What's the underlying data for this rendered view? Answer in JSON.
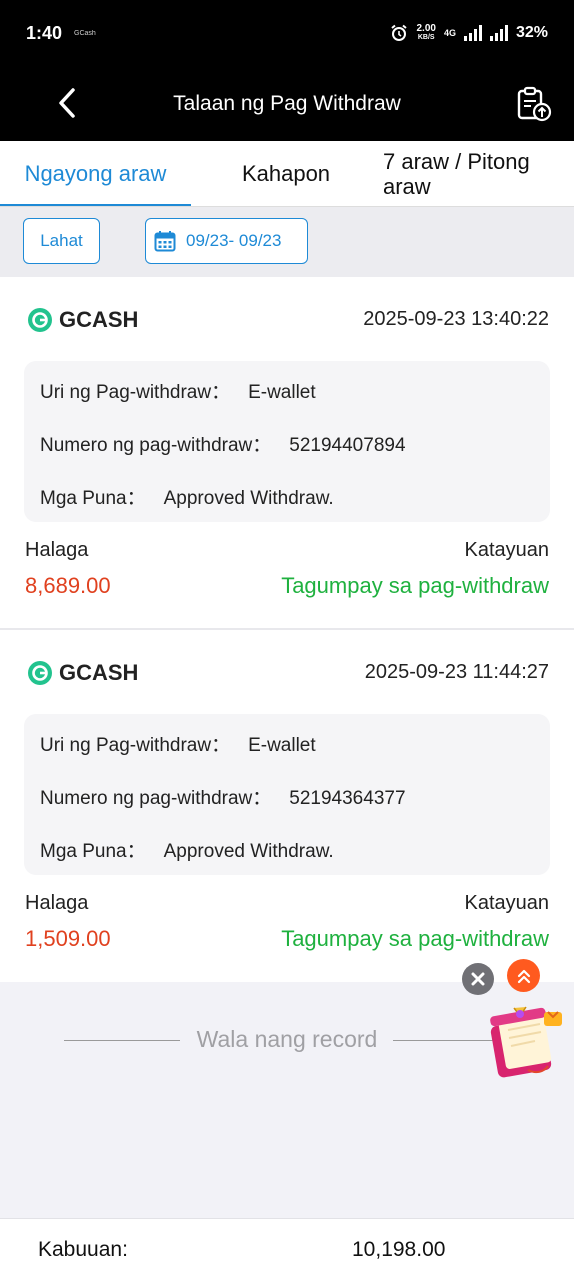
{
  "status_bar": {
    "time": "1:40",
    "app_hint": "GCash",
    "speed_value": "2.00",
    "speed_unit": "KB/S",
    "network": "4G",
    "battery": "32%"
  },
  "header": {
    "title": "Talaan ng Pag Withdraw",
    "back_icon": "back-chevron-icon",
    "export_icon": "clipboard-upload-icon"
  },
  "tabs": [
    {
      "label": "Ngayong araw",
      "active": true
    },
    {
      "label": "Kahapon",
      "active": false
    },
    {
      "label": "7 araw / Pitong araw",
      "active": false
    }
  ],
  "filters": {
    "all_label": "Lahat",
    "date_range": "09/23- 09/23",
    "calendar_icon": "calendar-icon"
  },
  "records": [
    {
      "provider": "GCASH",
      "timestamp": "2025-09-23 13:40:22",
      "type_label": "Uri ng Pag-withdraw：",
      "type_value": "E-wallet",
      "number_label": "Numero ng pag-withdraw：",
      "number_value": "52194407894",
      "remarks_label": "Mga Puna：",
      "remarks_value": "Approved Withdraw.",
      "amount_label": "Halaga",
      "amount": "8,689.00",
      "status_label": "Katayuan",
      "status": "Tagumpay sa pag-withdraw"
    },
    {
      "provider": "GCASH",
      "timestamp": "2025-09-23 11:44:27",
      "type_label": "Uri ng Pag-withdraw：",
      "type_value": "E-wallet",
      "number_label": "Numero ng pag-withdraw：",
      "number_value": "52194364377",
      "remarks_label": "Mga Puna：",
      "remarks_value": "Approved Withdraw.",
      "amount_label": "Halaga",
      "amount": "1,509.00",
      "status_label": "Katayuan",
      "status": "Tagumpay sa pag-withdraw"
    }
  ],
  "empty_text": "Wala nang record",
  "footer": {
    "total_label": "Kabuuan:",
    "total_value": "10,198.00"
  },
  "colors": {
    "accent": "#1e8ad6",
    "amount": "#e0411f",
    "success": "#1fb13f",
    "header_bg": "#000000"
  }
}
